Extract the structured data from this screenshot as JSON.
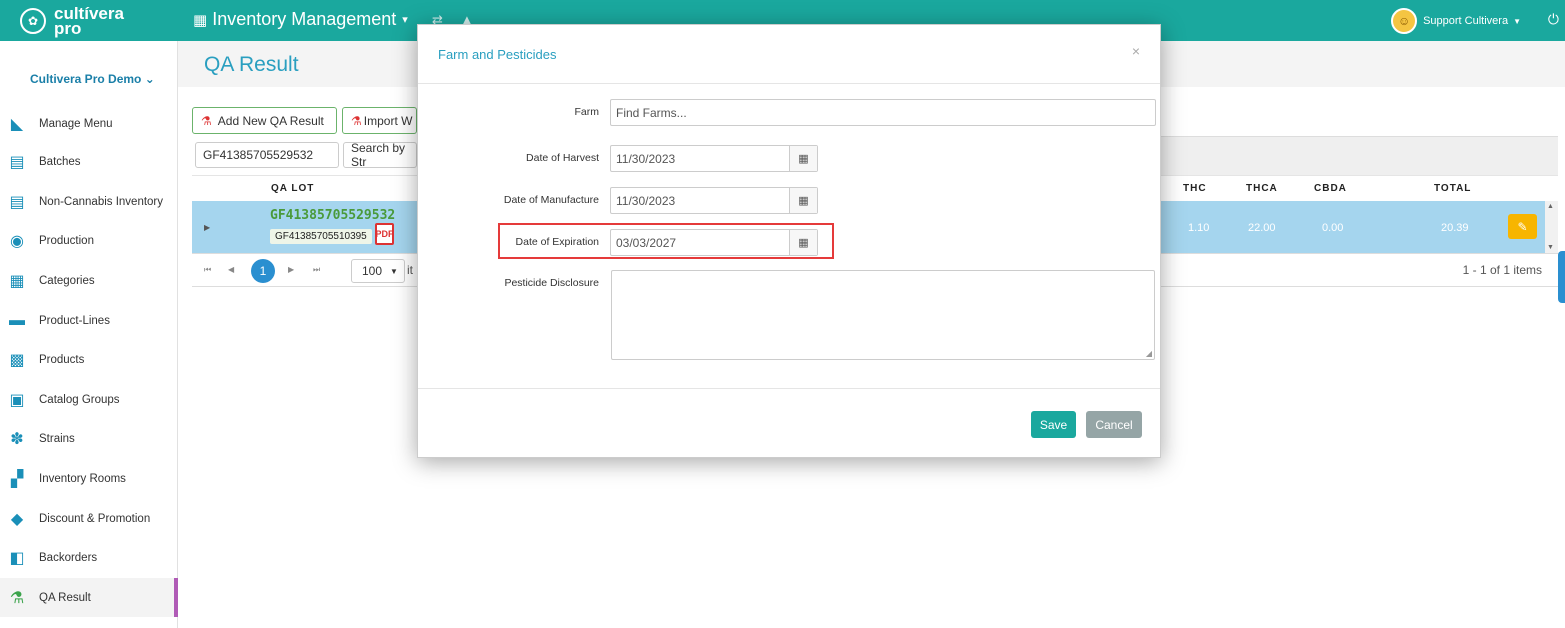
{
  "brand": {
    "line1": "cultívera",
    "line2": "pro"
  },
  "header": {
    "app_title": "Inventory Management",
    "user_name": "Support Cultivera"
  },
  "sidebar": {
    "tenant": "Cultivera Pro Demo",
    "items": [
      {
        "label": "Manage Menu",
        "icon": "pencil-icon"
      },
      {
        "label": "Batches",
        "icon": "list-icon"
      },
      {
        "label": "Non-Cannabis Inventory",
        "icon": "list-icon"
      },
      {
        "label": "Production",
        "icon": "production-icon"
      },
      {
        "label": "Categories",
        "icon": "grid-icon"
      },
      {
        "label": "Product-Lines",
        "icon": "product-lines-icon"
      },
      {
        "label": "Products",
        "icon": "products-icon"
      },
      {
        "label": "Catalog Groups",
        "icon": "catalog-icon"
      },
      {
        "label": "Strains",
        "icon": "strains-icon"
      },
      {
        "label": "Inventory Rooms",
        "icon": "rooms-icon"
      },
      {
        "label": "Discount & Promotion",
        "icon": "tag-icon"
      },
      {
        "label": "Backorders",
        "icon": "backorders-icon"
      },
      {
        "label": "QA Result",
        "icon": "flask-icon",
        "active": true
      }
    ]
  },
  "page": {
    "title": "QA Result"
  },
  "toolbar": {
    "add_label": "Add New QA Result",
    "import_label": "Import W",
    "search_value": "GF41385705529532",
    "search_placeholder": "Search by Str"
  },
  "grid": {
    "columns": {
      "qa_lot": "QA LOT",
      "thc": "THC",
      "thca": "THCA",
      "cbda": "CBDA",
      "total": "TOTAL"
    },
    "row": {
      "lot": "GF41385705529532",
      "sub_lot": "GF41385705510395",
      "thc": "1.10",
      "thca": "22.00",
      "cbda": "0.00",
      "total": "20.39"
    },
    "pager": {
      "page": "1",
      "per_page": "100",
      "items_label": "it",
      "count": "1 - 1 of 1 items"
    }
  },
  "modal": {
    "title": "Farm and Pesticides",
    "close": "×",
    "farm_label": "Farm",
    "farm_placeholder": "Find Farms...",
    "harvest_label": "Date of Harvest",
    "harvest_value": "11/30/2023",
    "manufacture_label": "Date of Manufacture",
    "manufacture_value": "11/30/2023",
    "expiration_label": "Date of Expiration",
    "expiration_value": "03/03/2027",
    "pesticide_label": "Pesticide Disclosure",
    "save_label": "Save",
    "cancel_label": "Cancel"
  },
  "colors": {
    "primary": "#1aa89e",
    "accent": "#2a9fc0",
    "highlight": "#e53a3a",
    "row_selected": "#a5d5ee",
    "warning": "#f7b500"
  }
}
